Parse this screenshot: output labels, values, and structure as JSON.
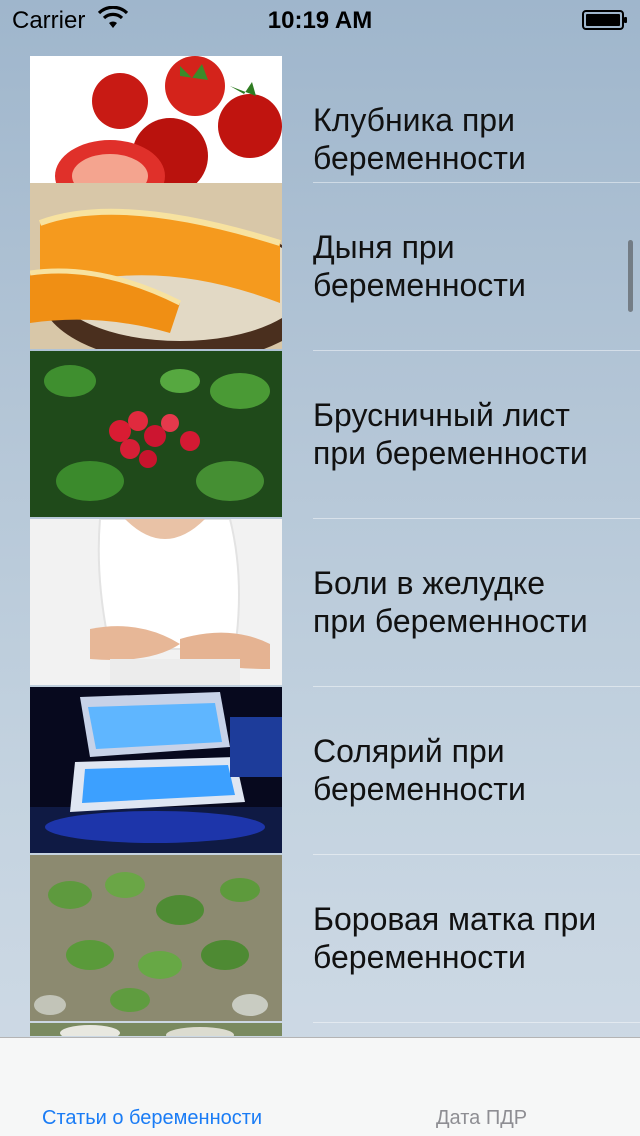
{
  "status_bar": {
    "carrier": "Carrier",
    "time": "10:19 AM",
    "wifi_icon": "wifi-icon",
    "battery_icon": "battery-icon"
  },
  "articles": [
    {
      "title": "Клубника при\nбеременности",
      "image": "strawberries"
    },
    {
      "title": "Дыня при\nбеременности",
      "image": "melon"
    },
    {
      "title": "Брусничный лист\nпри беременности",
      "image": "lingonberry"
    },
    {
      "title": "Боли в желудке\nпри беременности",
      "image": "stomach-pain"
    },
    {
      "title": "Солярий при\nбеременности",
      "image": "solarium"
    },
    {
      "title": "Боровая матка при\nбеременности",
      "image": "orthilia-plant"
    }
  ],
  "tab_bar": {
    "tabs": [
      {
        "label": "Статьи о беременности",
        "active": true
      },
      {
        "label": "Дата ПДР",
        "active": false
      }
    ],
    "active_color": "#1a7cf5",
    "inactive_color": "#8e8e93"
  }
}
